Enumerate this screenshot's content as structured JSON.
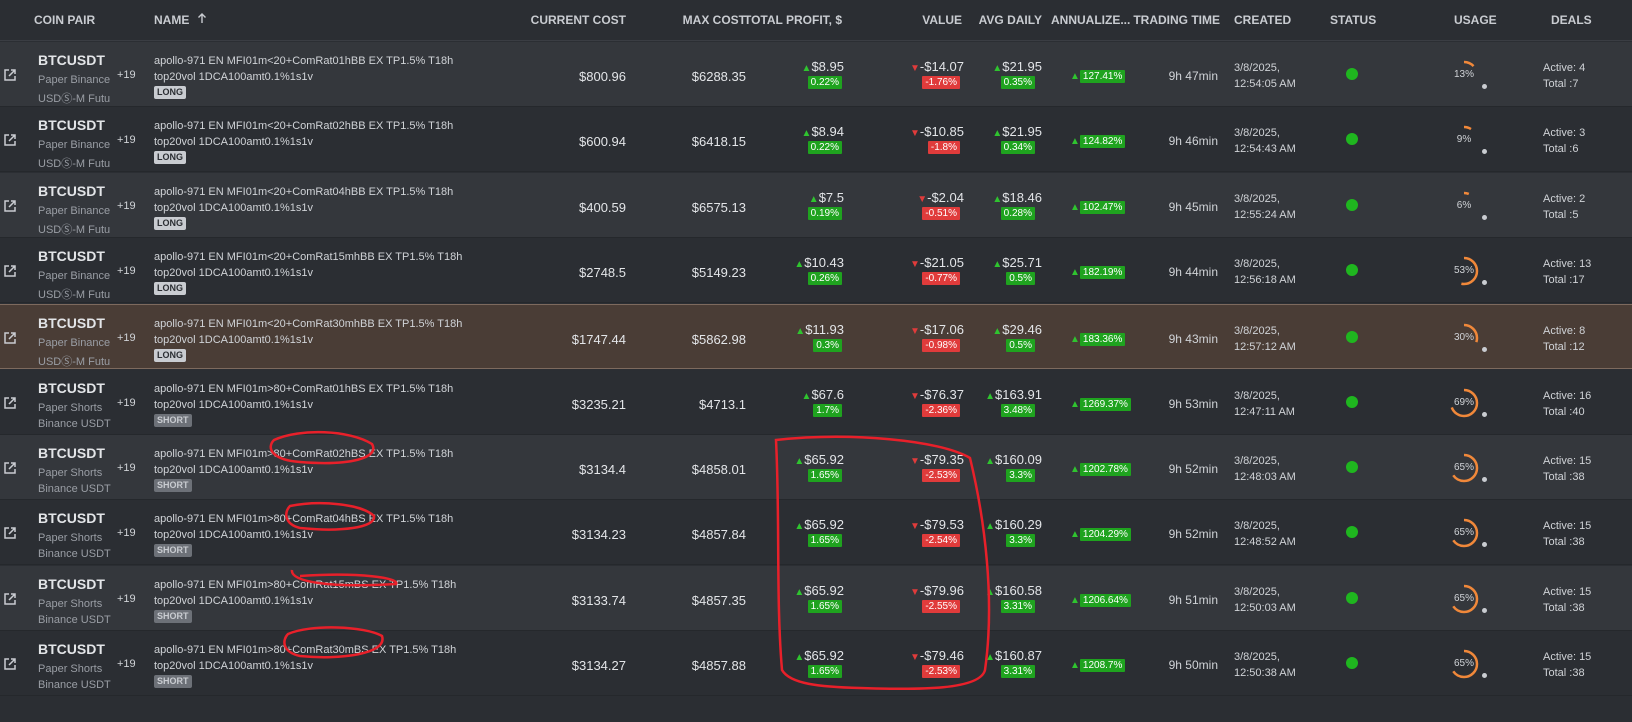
{
  "headers": {
    "coin_pair": "COIN PAIR",
    "name": "NAME",
    "current_cost": "CURRENT COST",
    "max_cost": "MAX COST",
    "total_profit": "TOTAL PROFIT, $",
    "value": "VALUE",
    "avg_daily": "AVG DAILY",
    "annualized": "ANNUALIZE...",
    "trading_time": "TRADING TIME",
    "created": "CREATED",
    "status": "STATUS",
    "usage": "USAGE",
    "deals": "DEALS",
    "sort_icon": "arrow-up-icon"
  },
  "colors": {
    "gain": "#1fa31f",
    "loss": "#e03b3b",
    "status_active": "#1fb61f",
    "gauge": "#f0883a",
    "highlight_row": "#4a3d36",
    "annotation": "#e8202a"
  },
  "rows": [
    {
      "pair": "BTCUSDT",
      "sub1": "Paper Binance",
      "sub2": "USDⓈ-M Futu",
      "plus": "+19",
      "name1": "apollo-971 EN MFI01m<20+ComRat01hBB EX TP1.5% T18h",
      "name2": "top20vol 1DCA100amt0.1%1s1v",
      "tag": "LONG",
      "current_cost": "$800.96",
      "max_cost": "$6288.35",
      "profit": "$8.95",
      "profit_pct": "0.22%",
      "value": "-$14.07",
      "value_pct": "-1.76%",
      "avg": "$21.95",
      "avg_pct": "0.35%",
      "ann": "127.41%",
      "ttime": "9h 47min",
      "created1": "3/8/2025,",
      "created2": "12:54:05 AM",
      "usage": "13%",
      "usage_value": 0.13,
      "active": "Active: 4",
      "total": "Total :7"
    },
    {
      "pair": "BTCUSDT",
      "sub1": "Paper Binance",
      "sub2": "USDⓈ-M Futu",
      "plus": "+19",
      "name1": "apollo-971 EN MFI01m<20+ComRat02hBB EX TP1.5% T18h",
      "name2": "top20vol 1DCA100amt0.1%1s1v",
      "tag": "LONG",
      "current_cost": "$600.94",
      "max_cost": "$6418.15",
      "profit": "$8.94",
      "profit_pct": "0.22%",
      "value": "-$10.85",
      "value_pct": "-1.8%",
      "avg": "$21.95",
      "avg_pct": "0.34%",
      "ann": "124.82%",
      "ttime": "9h 46min",
      "created1": "3/8/2025,",
      "created2": "12:54:43 AM",
      "usage": "9%",
      "usage_value": 0.09,
      "active": "Active: 3",
      "total": "Total :6"
    },
    {
      "pair": "BTCUSDT",
      "sub1": "Paper Binance",
      "sub2": "USDⓈ-M Futu",
      "plus": "+19",
      "name1": "apollo-971 EN MFI01m<20+ComRat04hBB EX TP1.5% T18h",
      "name2": "top20vol 1DCA100amt0.1%1s1v",
      "tag": "LONG",
      "current_cost": "$400.59",
      "max_cost": "$6575.13",
      "profit": "$7.5",
      "profit_pct": "0.19%",
      "value": "-$2.04",
      "value_pct": "-0.51%",
      "avg": "$18.46",
      "avg_pct": "0.28%",
      "ann": "102.47%",
      "ttime": "9h 45min",
      "created1": "3/8/2025,",
      "created2": "12:55:24 AM",
      "usage": "6%",
      "usage_value": 0.06,
      "active": "Active: 2",
      "total": "Total :5"
    },
    {
      "pair": "BTCUSDT",
      "sub1": "Paper Binance",
      "sub2": "USDⓈ-M Futu",
      "plus": "+19",
      "name1": "apollo-971 EN MFI01m<20+ComRat15mhBB EX TP1.5% T18h",
      "name2": "top20vol 1DCA100amt0.1%1s1v",
      "tag": "LONG",
      "current_cost": "$2748.5",
      "max_cost": "$5149.23",
      "profit": "$10.43",
      "profit_pct": "0.26%",
      "value": "-$21.05",
      "value_pct": "-0.77%",
      "avg": "$25.71",
      "avg_pct": "0.5%",
      "ann": "182.19%",
      "ttime": "9h 44min",
      "created1": "3/8/2025,",
      "created2": "12:56:18 AM",
      "usage": "53%",
      "usage_value": 0.53,
      "active": "Active: 13",
      "total": "Total :17"
    },
    {
      "pair": "BTCUSDT",
      "sub1": "Paper Binance",
      "sub2": "USDⓈ-M Futu",
      "plus": "+19",
      "name1": "apollo-971 EN MFI01m<20+ComRat30mhBB EX TP1.5% T18h",
      "name2": "top20vol 1DCA100amt0.1%1s1v",
      "tag": "LONG",
      "current_cost": "$1747.44",
      "max_cost": "$5862.98",
      "profit": "$11.93",
      "profit_pct": "0.3%",
      "value": "-$17.06",
      "value_pct": "-0.98%",
      "avg": "$29.46",
      "avg_pct": "0.5%",
      "ann": "183.36%",
      "ttime": "9h 43min",
      "created1": "3/8/2025,",
      "created2": "12:57:12 AM",
      "usage": "30%",
      "usage_value": 0.3,
      "active": "Active: 8",
      "total": "Total :12"
    },
    {
      "pair": "BTCUSDT",
      "sub1": "Paper Shorts",
      "sub2": "Binance USDT",
      "plus": "+19",
      "name1": "apollo-971 EN MFI01m>80+ComRat01hBS EX TP1.5% T18h",
      "name2": "top20vol 1DCA100amt0.1%1s1v",
      "tag": "SHORT",
      "current_cost": "$3235.21",
      "max_cost": "$4713.1",
      "profit": "$67.6",
      "profit_pct": "1.7%",
      "value": "-$76.37",
      "value_pct": "-2.36%",
      "avg": "$163.91",
      "avg_pct": "3.48%",
      "ann": "1269.37%",
      "ttime": "9h 53min",
      "created1": "3/8/2025,",
      "created2": "12:47:11 AM",
      "usage": "69%",
      "usage_value": 0.69,
      "active": "Active: 16",
      "total": "Total :40"
    },
    {
      "pair": "BTCUSDT",
      "sub1": "Paper Shorts",
      "sub2": "Binance USDT",
      "plus": "+19",
      "name1": "apollo-971 EN MFI01m>80+ComRat02hBS EX TP1.5% T18h",
      "name2": "top20vol 1DCA100amt0.1%1s1v",
      "tag": "SHORT",
      "current_cost": "$3134.4",
      "max_cost": "$4858.01",
      "profit": "$65.92",
      "profit_pct": "1.65%",
      "value": "-$79.35",
      "value_pct": "-2.53%",
      "avg": "$160.09",
      "avg_pct": "3.3%",
      "ann": "1202.78%",
      "ttime": "9h 52min",
      "created1": "3/8/2025,",
      "created2": "12:48:03 AM",
      "usage": "65%",
      "usage_value": 0.65,
      "active": "Active: 15",
      "total": "Total :38"
    },
    {
      "pair": "BTCUSDT",
      "sub1": "Paper Shorts",
      "sub2": "Binance USDT",
      "plus": "+19",
      "name1": "apollo-971 EN MFI01m>80+ComRat04hBS EX TP1.5% T18h",
      "name2": "top20vol 1DCA100amt0.1%1s1v",
      "tag": "SHORT",
      "current_cost": "$3134.23",
      "max_cost": "$4857.84",
      "profit": "$65.92",
      "profit_pct": "1.65%",
      "value": "-$79.53",
      "value_pct": "-2.54%",
      "avg": "$160.29",
      "avg_pct": "3.3%",
      "ann": "1204.29%",
      "ttime": "9h 52min",
      "created1": "3/8/2025,",
      "created2": "12:48:52 AM",
      "usage": "65%",
      "usage_value": 0.65,
      "active": "Active: 15",
      "total": "Total :38"
    },
    {
      "pair": "BTCUSDT",
      "sub1": "Paper Shorts",
      "sub2": "Binance USDT",
      "plus": "+19",
      "name1": "apollo-971 EN MFI01m>80+ComRat15mBS EX TP1.5% T18h",
      "name2": "top20vol 1DCA100amt0.1%1s1v",
      "tag": "SHORT",
      "current_cost": "$3133.74",
      "max_cost": "$4857.35",
      "profit": "$65.92",
      "profit_pct": "1.65%",
      "value": "-$79.96",
      "value_pct": "-2.55%",
      "avg": "$160.58",
      "avg_pct": "3.31%",
      "ann": "1206.64%",
      "ttime": "9h 51min",
      "created1": "3/8/2025,",
      "created2": "12:50:03 AM",
      "usage": "65%",
      "usage_value": 0.65,
      "active": "Active: 15",
      "total": "Total :38"
    },
    {
      "pair": "BTCUSDT",
      "sub1": "Paper Shorts",
      "sub2": "Binance USDT",
      "plus": "+19",
      "name1": "apollo-971 EN MFI01m>80+ComRat30mBS EX TP1.5% T18h",
      "name2": "top20vol 1DCA100amt0.1%1s1v",
      "tag": "SHORT",
      "current_cost": "$3134.27",
      "max_cost": "$4857.88",
      "profit": "$65.92",
      "profit_pct": "1.65%",
      "value": "-$79.46",
      "value_pct": "-2.53%",
      "avg": "$160.87",
      "avg_pct": "3.31%",
      "ann": "1208.7%",
      "ttime": "9h 50min",
      "created1": "3/8/2025,",
      "created2": "12:50:38 AM",
      "usage": "65%",
      "usage_value": 0.65,
      "active": "Active: 15",
      "total": "Total :38"
    }
  ]
}
